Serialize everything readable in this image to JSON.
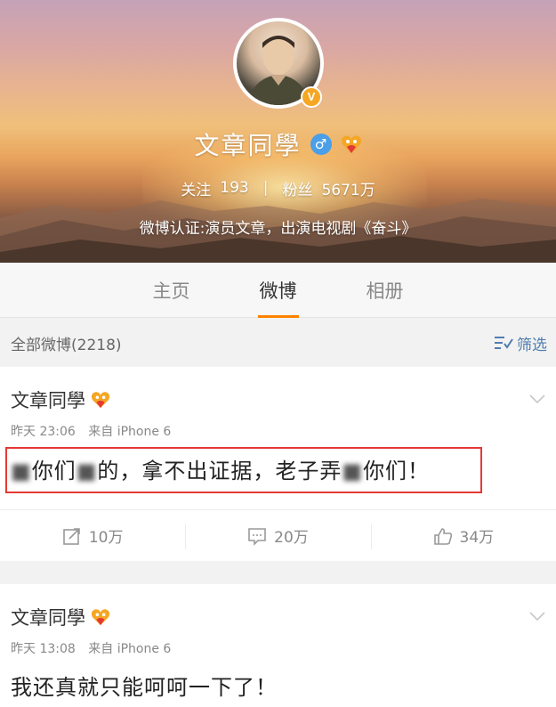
{
  "profile": {
    "name": "文章同學",
    "follow_label": "关注",
    "follow_count": "193",
    "separator": "|",
    "fans_label": "粉丝",
    "fans_count": "5671万",
    "verification": "微博认证:演员文章，出演电视剧《奋斗》",
    "gender_symbol": "♂",
    "verified_badge": "V"
  },
  "tabs": [
    {
      "label": "主页",
      "active": false
    },
    {
      "label": "微博",
      "active": true
    },
    {
      "label": "相册",
      "active": false
    }
  ],
  "filter": {
    "count_label": "全部微博(2218)",
    "filter_label": "筛选"
  },
  "posts": [
    {
      "author": "文章同學",
      "time": "昨天 23:06",
      "source": "来自 iPhone 6",
      "text_parts": [
        "",
        "你们",
        "的，拿不出证据，老子弄",
        "你们！"
      ],
      "blurred_parts": [
        "■",
        "■",
        "■"
      ],
      "actions": {
        "repost": "10万",
        "comment": "20万",
        "like": "34万"
      }
    },
    {
      "author": "文章同學",
      "time": "昨天 13:08",
      "source": "来自 iPhone 6",
      "text": "我还真就只能呵呵一下了！"
    }
  ],
  "colors": {
    "accent_orange": "#ff8200",
    "link_blue": "#507daf",
    "highlight_red": "#e53935",
    "gender_blue": "#4a9fe8",
    "badge_gold": "#f5a623"
  },
  "icons": {
    "filter": "filter-icon",
    "repost": "repost-icon",
    "comment": "comment-icon",
    "like": "thumbs-up-icon",
    "chevron": "chevron-down-icon"
  }
}
